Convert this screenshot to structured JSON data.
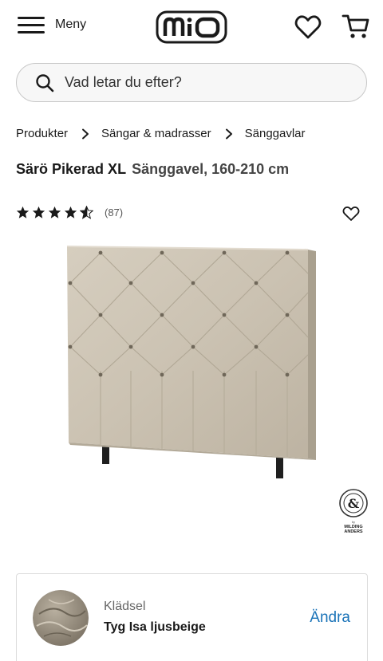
{
  "header": {
    "menu_label": "Meny",
    "logo_text": "mio",
    "icons": {
      "menu": "hamburger-icon",
      "wishlist": "heart-icon",
      "cart": "cart-icon"
    }
  },
  "search": {
    "placeholder": "Vad letar du efter?",
    "value": "",
    "icon": "search-icon"
  },
  "breadcrumb": {
    "items": [
      {
        "label": "Produkter"
      },
      {
        "label": "Sängar & madrasser"
      },
      {
        "label": "Sänggavlar"
      }
    ]
  },
  "product": {
    "name": "Särö Pikerad XL",
    "subtitle": "Sänggavel, 160-210 cm",
    "rating": 4.5,
    "review_count": "(87)",
    "brand_seal_text": "MILDING ANDERS",
    "colors": {
      "fabric": "#cfc6b6",
      "legs": "#1f1f1f"
    }
  },
  "option": {
    "label": "Klädsel",
    "value": "Tyg Isa ljusbeige",
    "action": "Ändra",
    "accent_color": "#1a73b8"
  }
}
